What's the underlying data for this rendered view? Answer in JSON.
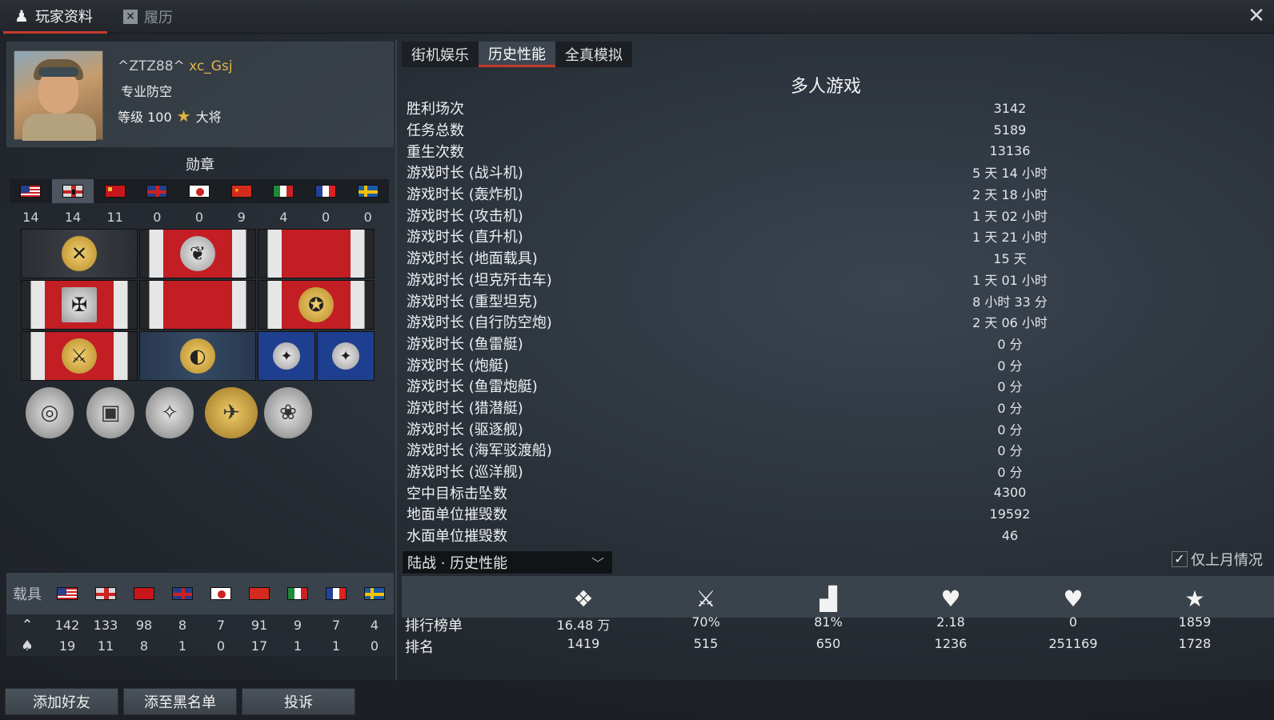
{
  "tabs": [
    {
      "label": "玩家资料",
      "active": true,
      "icon": "player-icon"
    },
    {
      "label": "履历",
      "active": false,
      "icon": "record-icon"
    }
  ],
  "profile": {
    "nick_prefix": "^ZTZ88^",
    "nick_name": "xc_Gsj",
    "title": "专业防空",
    "level_label": "等级 100",
    "rank_name": "大将"
  },
  "medals": {
    "heading": "勋章",
    "nations": [
      "usa",
      "germany",
      "ussr",
      "britain",
      "japan",
      "china",
      "italy",
      "france",
      "sweden"
    ],
    "selected_index": 1,
    "counts": [
      "14",
      "14",
      "11",
      "0",
      "0",
      "9",
      "4",
      "0",
      "0"
    ]
  },
  "vehicles": {
    "label": "载具",
    "nations": [
      "usa",
      "germany",
      "ussr",
      "britain",
      "japan",
      "china",
      "italy",
      "france",
      "sweden"
    ],
    "row_total": [
      "142",
      "133",
      "98",
      "8",
      "7",
      "91",
      "9",
      "7",
      "4"
    ],
    "row_elite": [
      "19",
      "11",
      "8",
      "1",
      "0",
      "17",
      "1",
      "1",
      "0"
    ]
  },
  "buttons": {
    "add_friend": "添加好友",
    "blacklist": "添至黑名单",
    "report": "投诉"
  },
  "mode_tabs": [
    {
      "label": "街机娱乐",
      "active": false
    },
    {
      "label": "历史性能",
      "active": true
    },
    {
      "label": "全真模拟",
      "active": false
    }
  ],
  "stats": {
    "title": "多人游戏",
    "rows": [
      {
        "label": "胜利场次",
        "value": "3142"
      },
      {
        "label": "任务总数",
        "value": "5189"
      },
      {
        "label": "重生次数",
        "value": "13136"
      },
      {
        "label": "游戏时长 (战斗机)",
        "value": "5 天 14 小时"
      },
      {
        "label": "游戏时长 (轰炸机)",
        "value": "2 天 18 小时"
      },
      {
        "label": "游戏时长 (攻击机)",
        "value": "1 天 02 小时"
      },
      {
        "label": "游戏时长 (直升机)",
        "value": "1 天 21 小时"
      },
      {
        "label": "游戏时长 (地面载具)",
        "value": "15 天"
      },
      {
        "label": "游戏时长 (坦克歼击车)",
        "value": "1 天 01 小时"
      },
      {
        "label": "游戏时长 (重型坦克)",
        "value": "8 小时 33 分"
      },
      {
        "label": "游戏时长 (自行防空炮)",
        "value": "2 天 06 小时"
      },
      {
        "label": "游戏时长 (鱼雷艇)",
        "value": "0 分"
      },
      {
        "label": "游戏时长 (炮艇)",
        "value": "0 分"
      },
      {
        "label": "游戏时长 (鱼雷炮艇)",
        "value": "0 分"
      },
      {
        "label": "游戏时长 (猎潜艇)",
        "value": "0 分"
      },
      {
        "label": "游戏时长 (驱逐舰)",
        "value": "0 分"
      },
      {
        "label": "游戏时长 (海军驳渡船)",
        "value": "0 分"
      },
      {
        "label": "游戏时长 (巡洋舰)",
        "value": "0 分"
      },
      {
        "label": "空中目标击坠数",
        "value": "4300"
      },
      {
        "label": "地面单位摧毁数",
        "value": "19592"
      },
      {
        "label": "水面单位摧毁数",
        "value": "46"
      }
    ]
  },
  "dropdown": {
    "value": "陆战 · 历史性能"
  },
  "checkbox": {
    "label": "仅上月情况",
    "checked": true
  },
  "ranking": {
    "row1_label": "排行榜单",
    "row2_label": "排名",
    "icons": [
      "player-rank-icon",
      "victories-icon",
      "podium-icon",
      "kills-per-spawn-icon",
      "air-kills-per-death-icon",
      "star-icon"
    ],
    "row1": [
      "16.48 万",
      "70%",
      "81%",
      "2.18",
      "0",
      "1859"
    ],
    "row2": [
      "1419",
      "515",
      "650",
      "1236",
      "251169",
      "1728"
    ]
  }
}
